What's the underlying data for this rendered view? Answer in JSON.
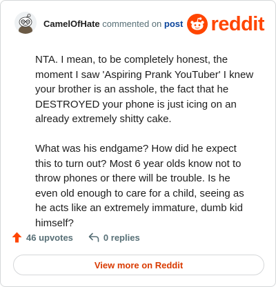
{
  "brand": {
    "name": "reddit",
    "color": "#ff4500"
  },
  "header": {
    "username": "CamelOfHate",
    "action_text": "commented on",
    "target_text": "post"
  },
  "comment": {
    "paragraphs": [
      "NTA. I mean, to be completely honest, the moment I saw 'Aspiring Prank YouTuber' I knew your brother is an asshole, the fact that he DESTROYED your phone is just icing on an already extremely shitty cake.",
      "What was his endgame? How did he expect this to turn out? Most 6 year olds know not to throw phones or there will be trouble. Is he even old enough to care for a child, seeing as he acts like an extremely immature, dumb kid himself?"
    ]
  },
  "footer": {
    "upvotes_text": "46 upvotes",
    "replies_text": "0 replies",
    "view_more_label": "View more on Reddit"
  },
  "colors": {
    "upvote": "#ff4500",
    "link": "#d93a00",
    "muted": "#576f76"
  },
  "icons": {
    "avatar": "snoo-avatar-icon",
    "logo": "reddit-snoo-icon",
    "upvote": "upvote-arrow-icon",
    "reply": "reply-arrow-icon"
  }
}
